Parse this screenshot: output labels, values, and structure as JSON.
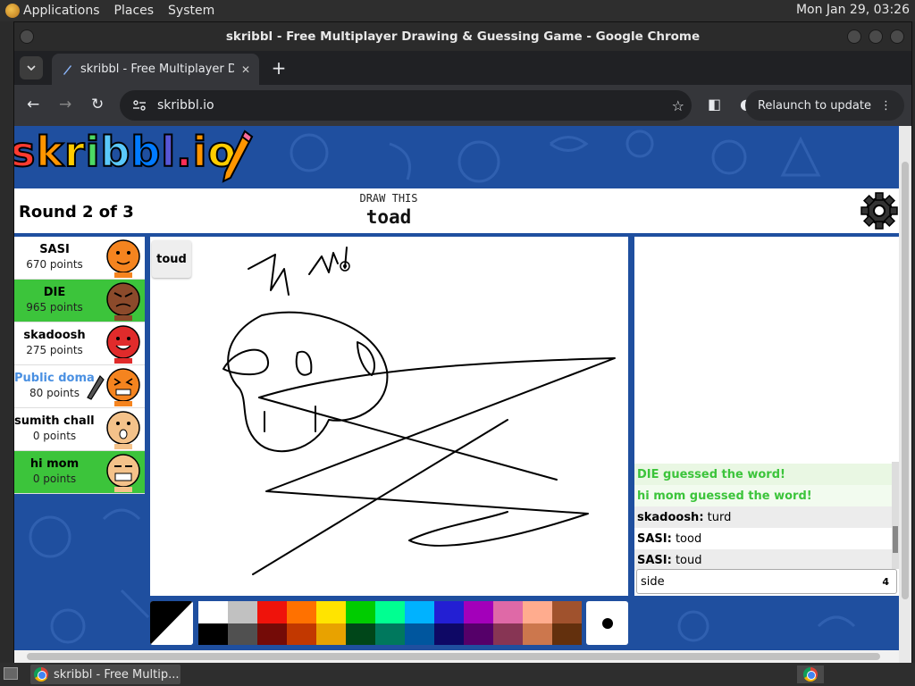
{
  "desktop": {
    "menus": [
      "Applications",
      "Places",
      "System"
    ],
    "clock": "Mon Jan 29, 03:26"
  },
  "window": {
    "title": "skribbl - Free Multiplayer Drawing & Guessing Game - Google Chrome"
  },
  "browser": {
    "tab_label": "skribbl - Free Multiplayer Drawing & Guessing Game",
    "url": "skribbl.io",
    "relaunch_label": "Relaunch to update"
  },
  "game": {
    "logo": "skribbl.io",
    "round": "Round 2 of 3",
    "draw_this": "DRAW THIS",
    "word": "toad",
    "last_guess": "toud",
    "players": [
      {
        "name": "SASI",
        "points": "670 points",
        "color": "#f5841f",
        "highlight": false
      },
      {
        "name": "DIE",
        "points": "965 points",
        "color": "#8b4a2b",
        "highlight": true
      },
      {
        "name": "skadoosh",
        "points": "275 points",
        "color": "#e02b2b",
        "highlight": false
      },
      {
        "name": "Public domain (You)",
        "points": "80 points",
        "color": "#f5841f",
        "highlight": false,
        "you": true
      },
      {
        "name": "sumith challa",
        "points": "0 points",
        "color": "#f4c28a",
        "highlight": false
      },
      {
        "name": "hi mom",
        "points": "0 points",
        "color": "#f4c28a",
        "highlight": true
      }
    ],
    "chat": [
      {
        "type": "guessed",
        "text": "DIE guessed the word!"
      },
      {
        "type": "guessed",
        "text": "hi mom guessed the word!"
      },
      {
        "type": "msg",
        "user": "skadoosh:",
        "text": " turd"
      },
      {
        "type": "msg",
        "user": "SASI:",
        "text": " tood"
      },
      {
        "type": "msg",
        "user": "SASI:",
        "text": " toud"
      }
    ],
    "chat_input": {
      "value": "side",
      "count": "4"
    },
    "palette": {
      "top": [
        "#ffffff",
        "#c1c1c1",
        "#ef130b",
        "#ff7100",
        "#ffe400",
        "#00cc00",
        "#00ff91",
        "#00b2ff",
        "#231fd3",
        "#a300ba",
        "#df69a7",
        "#ffac8e",
        "#a0522d"
      ],
      "bottom": [
        "#000000",
        "#505050",
        "#740b07",
        "#c23800",
        "#e8a200",
        "#004619",
        "#00785d",
        "#00569e",
        "#0e0865",
        "#550069",
        "#873554",
        "#cc774d",
        "#63300d"
      ]
    },
    "accent_bg": "#1f4f9f",
    "guessed_color": "#3cc43b"
  },
  "taskbar": {
    "task_label": "skribbl - Free Multip..."
  }
}
